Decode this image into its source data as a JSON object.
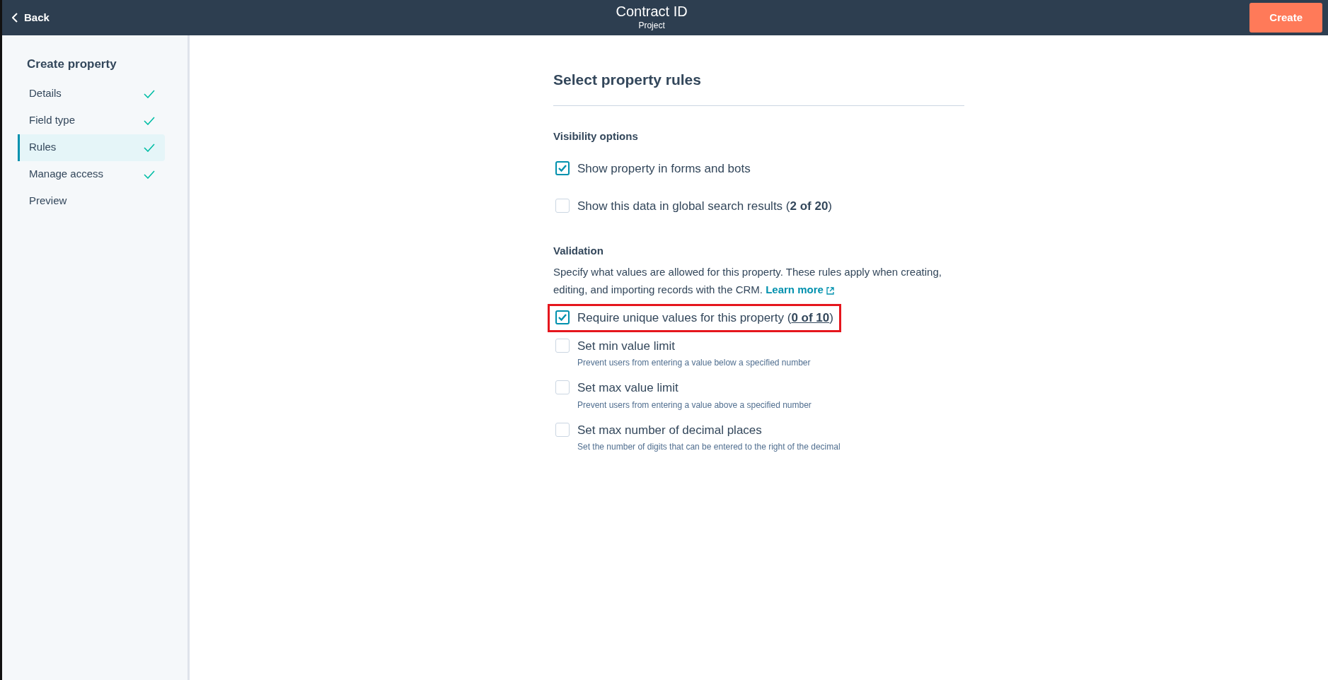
{
  "header": {
    "back": "Back",
    "title": "Contract ID",
    "subtitle": "Project",
    "action": "Create"
  },
  "sidebar": {
    "title": "Create property",
    "items": [
      {
        "label": "Details",
        "done": true,
        "selected": false
      },
      {
        "label": "Field type",
        "done": true,
        "selected": false
      },
      {
        "label": "Rules",
        "done": true,
        "selected": true
      },
      {
        "label": "Manage access",
        "done": true,
        "selected": false
      },
      {
        "label": "Preview",
        "done": false,
        "selected": false
      }
    ]
  },
  "main": {
    "title": "Select property rules",
    "sections": [
      {
        "heading": "Visibility options",
        "rules": [
          {
            "label": "Show property in forms and bots",
            "checked": true,
            "highlighted": false
          },
          {
            "label": "Show this data in global search results (",
            "count": "2 of 20",
            "tail": ")",
            "checked": false,
            "highlighted": false
          }
        ]
      },
      {
        "heading": "Validation",
        "description": "Specify what values are allowed for this property. These rules apply when creating, editing, and importing records with the CRM.",
        "link": "Learn more",
        "rules": [
          {
            "label": "Require unique values for this property (",
            "count_link": "0 of 10",
            "tail": ")",
            "checked": true,
            "highlighted": true
          },
          {
            "label": "Set min value limit",
            "hint": "Prevent users from entering a value below a specified number",
            "checked": false,
            "highlighted": false
          },
          {
            "label": "Set max value limit",
            "hint": "Prevent users from entering a value above a specified number",
            "checked": false,
            "highlighted": false
          },
          {
            "label": "Set max number of decimal places",
            "hint": "Set the number of digits that can be entered to the right of the decimal",
            "checked": false,
            "highlighted": false
          }
        ]
      }
    ]
  }
}
